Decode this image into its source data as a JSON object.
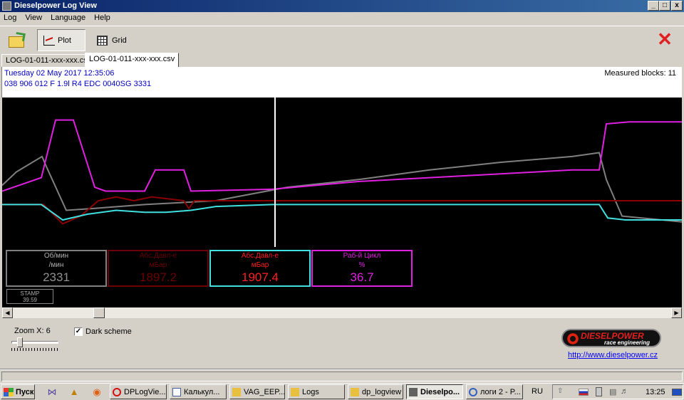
{
  "window": {
    "title": "Dieselpower Log View",
    "min": "_",
    "max": "□",
    "close": "x"
  },
  "menu": [
    "Log",
    "View",
    "Language",
    "Help"
  ],
  "toolbar": {
    "plot_label": "Plot",
    "grid_label": "Grid",
    "close_glyph": "✕"
  },
  "tabs": [
    "LOG-01-011-xxx-xxx.csv",
    "LOG-01-011-xxx-xxx.csv"
  ],
  "info": {
    "date": "Tuesday 02 May 2017 12:35:06",
    "ecu": "038 906 012 F  1.9l R4 EDC 0040SG  3331",
    "measured_blocks": "Measured blocks: 11"
  },
  "gauges": [
    {
      "label1": "Об/мин",
      "label2": "/мин",
      "value": "2331",
      "color": "#808080",
      "label_color": "#b0b0b0",
      "value_color": "#909090"
    },
    {
      "label1": "Абс.Давл-е",
      "label2": "мБар",
      "value": "1897.2",
      "color": "#6a0000",
      "label_color": "#6a0000",
      "value_color": "#6a0000"
    },
    {
      "label1": "Абс.Давл-е",
      "label2": "мБар",
      "value": "1907.4",
      "color": "#40e0e0",
      "label_color": "#ff2020",
      "value_color": "#ff2020"
    },
    {
      "label1": "Раб-й Цикл",
      "label2": "%",
      "value": "36.7",
      "color": "#e020e0",
      "label_color": "#e020e0",
      "value_color": "#e020e0"
    }
  ],
  "stamp": {
    "label": "STAMP",
    "value": "39.59"
  },
  "controls": {
    "zoom_label": "Zoom X: 6",
    "dark_scheme_label": "Dark scheme",
    "dark_scheme_checked": true,
    "check_glyph": "✓"
  },
  "brand": {
    "name": "DIESELPOWER",
    "tagline": "race engineering",
    "url": "http://www.dieselpower.cz"
  },
  "taskbar": {
    "start_label": "Пуск",
    "buttons": [
      {
        "label": "DPLogVie...",
        "active": false
      },
      {
        "label": "Калькул...",
        "active": false
      },
      {
        "label": "VAG_EEP...",
        "active": false
      },
      {
        "label": "Logs",
        "active": false
      },
      {
        "label": "dp_logview",
        "active": false
      },
      {
        "label": "Dieselpo...",
        "active": true
      },
      {
        "label": "логи 2 - P...",
        "active": false
      }
    ],
    "lang": "RU",
    "clock": "13:25"
  },
  "chart_data": {
    "type": "line",
    "title": "",
    "xlabel": "",
    "ylabel": "",
    "series": [
      {
        "name": "Об/мин",
        "color": "#808080",
        "x": [
          0,
          20,
          56,
          63,
          90,
          130,
          200,
          300,
          400,
          500,
          600,
          700,
          800,
          838,
          848,
          870,
          954
        ],
        "y": [
          0.58,
          0.65,
          0.73,
          0.67,
          0.45,
          0.46,
          0.48,
          0.5,
          0.57,
          0.61,
          0.66,
          0.7,
          0.73,
          0.75,
          0.61,
          0.42,
          0.39
        ]
      },
      {
        "name": "Абс.Давл-е 1",
        "color": "#8b0000",
        "x": [
          0,
          58,
          85,
          110,
          135,
          160,
          185,
          210,
          255,
          262,
          270,
          954
        ],
        "y": [
          0.48,
          0.48,
          0.38,
          0.42,
          0.5,
          0.52,
          0.5,
          0.52,
          0.5,
          0.46,
          0.5,
          0.5
        ]
      },
      {
        "name": "Абс.Давл-е 2",
        "color": "#40e0e0",
        "x": [
          0,
          55,
          85,
          120,
          160,
          200,
          230,
          265,
          300,
          380,
          420,
          500,
          600,
          700,
          800,
          838,
          850,
          875,
          954
        ],
        "y": [
          0.48,
          0.48,
          0.4,
          0.43,
          0.45,
          0.44,
          0.44,
          0.45,
          0.47,
          0.48,
          0.48,
          0.48,
          0.48,
          0.48,
          0.48,
          0.48,
          0.41,
          0.4,
          0.4
        ]
      },
      {
        "name": "Раб-й Цикл",
        "color": "#e020e0",
        "x": [
          0,
          55,
          75,
          100,
          130,
          145,
          200,
          215,
          255,
          265,
          380,
          500,
          600,
          700,
          800,
          838,
          848,
          880,
          954
        ],
        "y": [
          0.55,
          0.62,
          0.92,
          0.92,
          0.57,
          0.55,
          0.55,
          0.66,
          0.66,
          0.55,
          0.56,
          0.6,
          0.62,
          0.64,
          0.66,
          0.66,
          0.9,
          0.91,
          0.91
        ]
      }
    ],
    "cursor_x": 383,
    "xlim": [
      0,
      954
    ],
    "ylim": [
      0,
      1
    ],
    "grid": false
  }
}
